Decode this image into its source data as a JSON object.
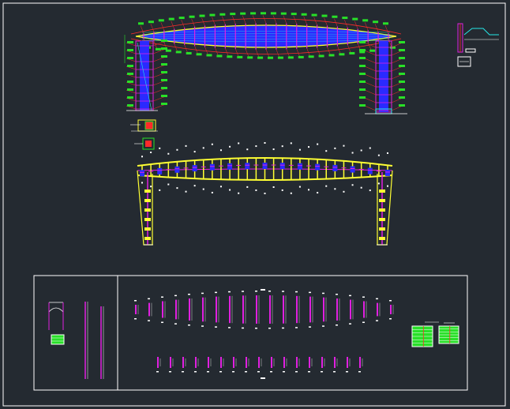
{
  "drawing": {
    "background": "#242a31",
    "colors": {
      "magenta": "#e020e0",
      "red": "#ff2a2a",
      "yellow": "#ffff33",
      "blue": "#2a2aff",
      "cyan": "#25e8e8",
      "green": "#28e028",
      "white": "#ffffff"
    },
    "elevation_label": "",
    "table_label": ""
  }
}
